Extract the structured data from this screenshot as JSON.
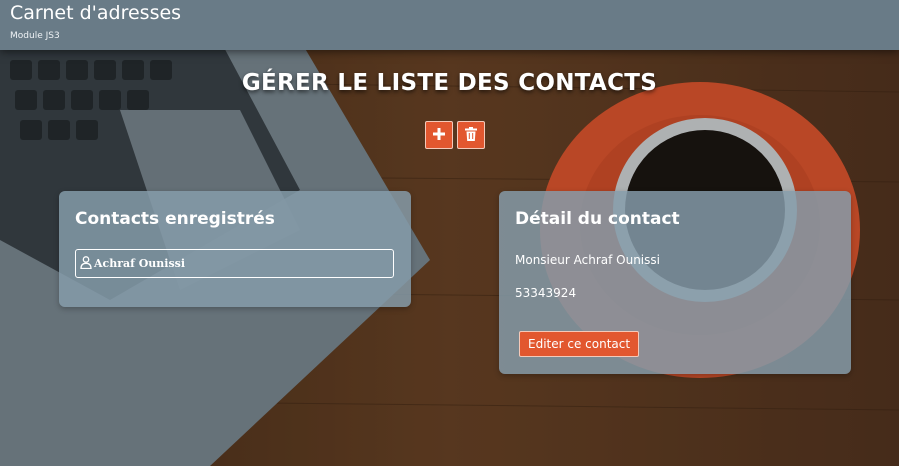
{
  "header": {
    "title": "Carnet d'adresses",
    "subtitle": "Module JS3"
  },
  "main": {
    "title": "GÉRER LE LISTE DES CONTACTS",
    "toolbar": {
      "add_icon": "plus-icon",
      "delete_icon": "trash-icon"
    }
  },
  "contacts_panel": {
    "title": "Contacts enregistrés",
    "items": [
      {
        "name": "Achraf Ounissi",
        "icon": "user-icon"
      }
    ]
  },
  "detail_panel": {
    "title": "Détail du contact",
    "full_name": "Monsieur Achraf Ounissi",
    "phone": "53343924",
    "edit_label": "Editer ce contact"
  },
  "colors": {
    "header": "#697b87",
    "accent": "#e2572f",
    "panel": "#859caa"
  }
}
